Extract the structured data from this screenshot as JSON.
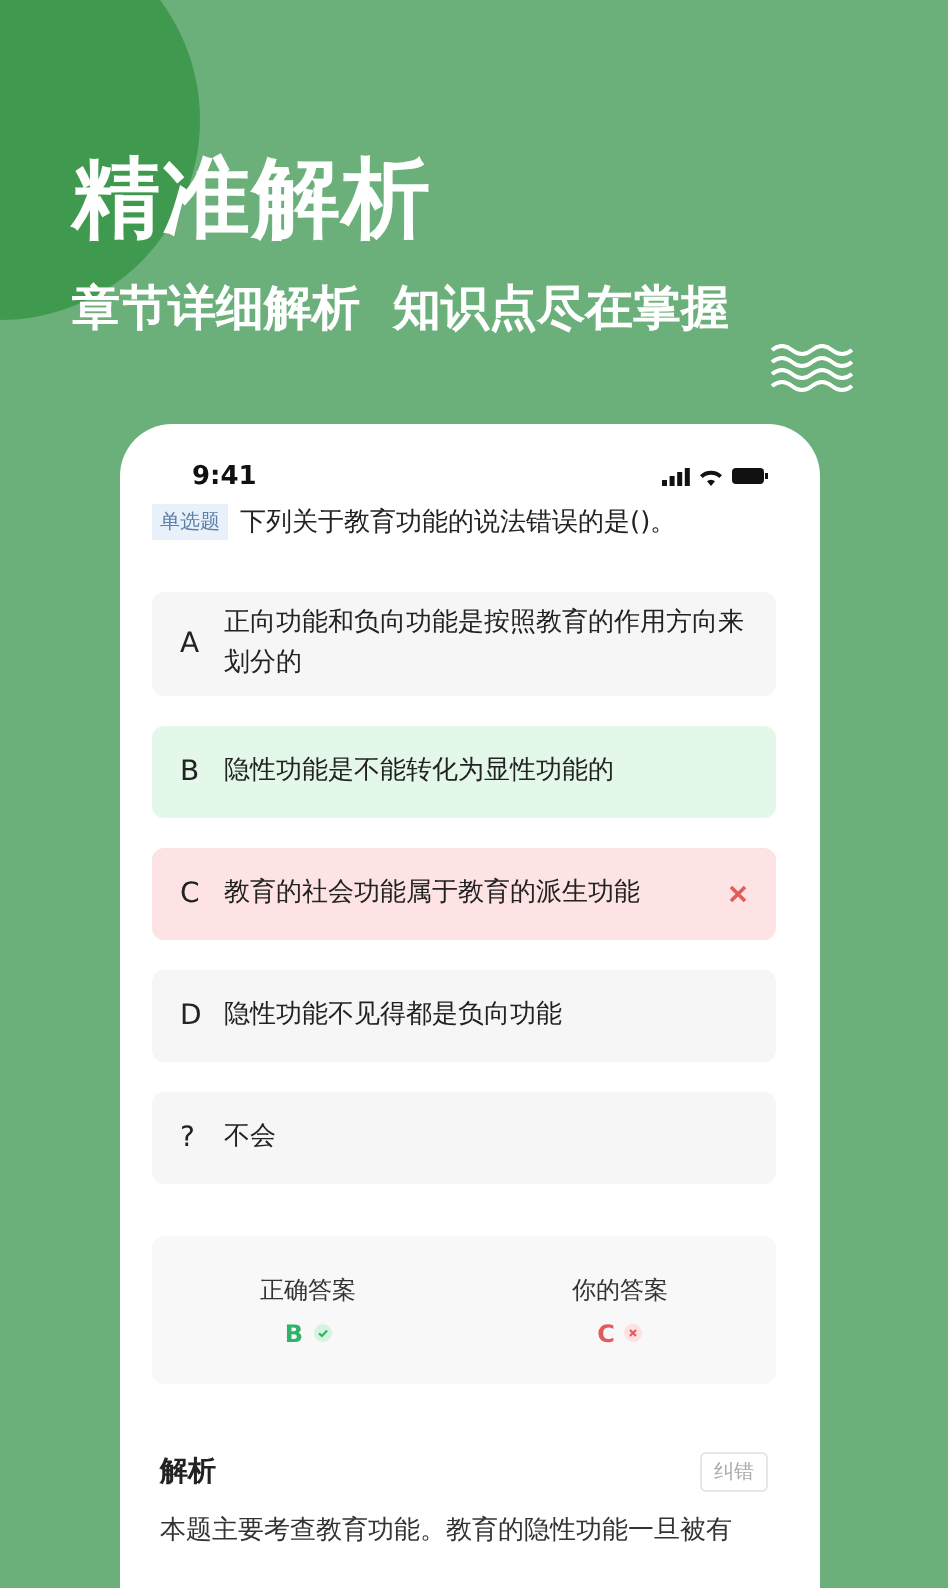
{
  "headline": "精准解析",
  "subheadline": "章节详细解析  知识点尽在掌握",
  "phone": {
    "status_time": "9:41",
    "question": {
      "tag": "单选题",
      "text": "下列关于教育功能的说法错误的是()。"
    },
    "options": [
      {
        "letter": "A",
        "text": "正向功能和负向功能是按照教育的作用方向来划分的",
        "selected": false,
        "correct": false
      },
      {
        "letter": "B",
        "text": "隐性功能是不能转化为显性功能的",
        "selected": false,
        "correct": true
      },
      {
        "letter": "C",
        "text": "教育的社会功能属于教育的派生功能",
        "selected": true,
        "correct": false
      },
      {
        "letter": "D",
        "text": "隐性功能不见得都是负向功能",
        "selected": false,
        "correct": false
      },
      {
        "letter": "?",
        "text": "不会",
        "selected": false,
        "correct": false
      }
    ],
    "summary": [
      {
        "label": "正确答案",
        "answer": "B",
        "correct": true
      },
      {
        "label": "你的答案",
        "answer": "C",
        "correct": false
      }
    ],
    "analysis": {
      "title": "解析",
      "report_button": "纠错",
      "text": "本题主要考查教育功能。教育的隐性功能一旦被有"
    }
  }
}
